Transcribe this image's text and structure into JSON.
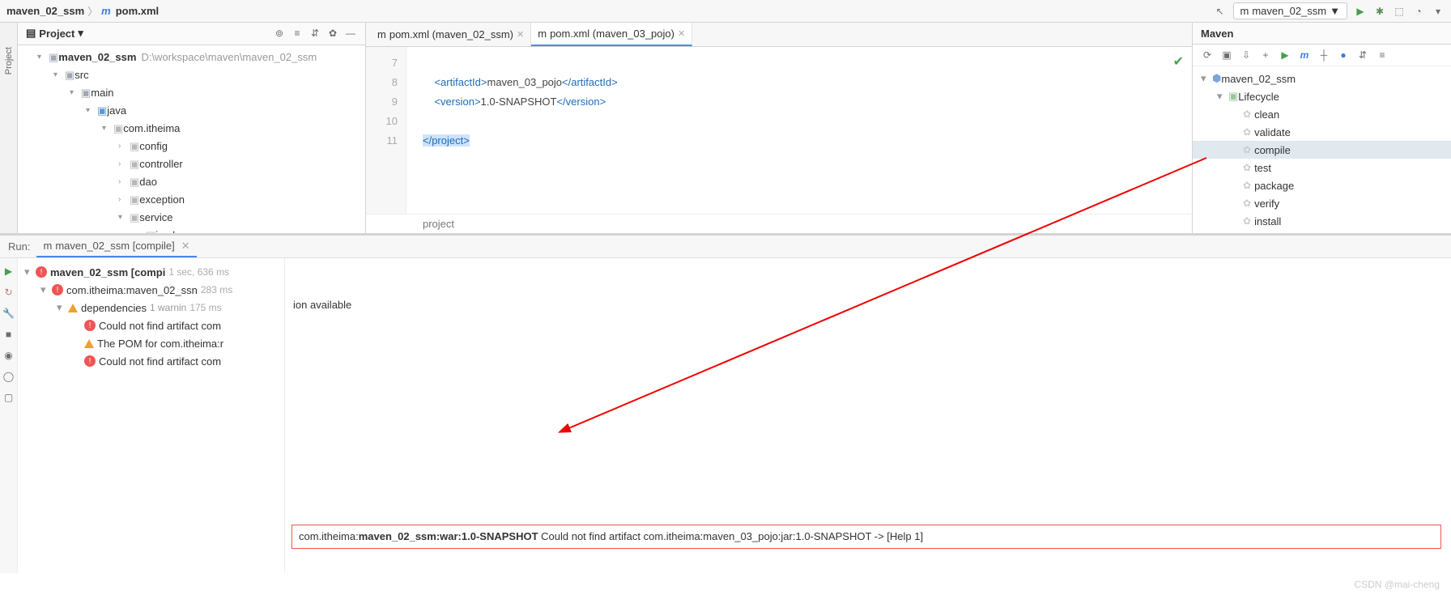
{
  "breadcrumb": {
    "root": "maven_02_ssm",
    "file": "pom.xml"
  },
  "runConfig": {
    "label": "maven_02_ssm"
  },
  "project": {
    "panelTitle": "Project",
    "root": {
      "name": "maven_02_ssm",
      "path": "D:\\workspace\\maven\\maven_02_ssm"
    },
    "nodes": [
      "src",
      "main",
      "java",
      "com.itheima",
      "config",
      "controller",
      "dao",
      "exception",
      "service",
      "impl"
    ]
  },
  "editor": {
    "tabs": [
      {
        "label": "pom.xml (maven_02_ssm)"
      },
      {
        "label": "pom.xml (maven_03_pojo)"
      }
    ],
    "lines": [
      "7",
      "8",
      "9",
      "10",
      "11"
    ],
    "l8": {
      "tag1": "<artifactId>",
      "txt": "maven_03_pojo",
      "tag2": "</artifactId>"
    },
    "l9": {
      "tag1": "<version>",
      "txt": "1.0-SNAPSHOT",
      "tag2": "</version>"
    },
    "l11": "</project>",
    "breadcrumb": "project"
  },
  "maven": {
    "title": "Maven",
    "root": "maven_02_ssm",
    "lifecycle": "Lifecycle",
    "goals": [
      "clean",
      "validate",
      "compile",
      "test",
      "package",
      "verify",
      "install"
    ]
  },
  "run": {
    "title": "Run:",
    "tab": "maven_02_ssm [compile]",
    "root": {
      "name": "maven_02_ssm [compi",
      "time": "1 sec, 636 ms"
    },
    "sub": {
      "name": "com.itheima:maven_02_ssn",
      "time": "283 ms"
    },
    "deps": {
      "name": "dependencies",
      "warn": "1 warnin",
      "time": "175 ms"
    },
    "items": [
      "Could not find artifact com",
      "The POM for com.itheima:r",
      "Could not find artifact com"
    ],
    "frag": "ion available",
    "error": {
      "pre": "com.itheima:",
      "art": "maven_02_ssm:war:1.0-SNAPSHOT",
      "msg": "  Could not find artifact com.itheima:maven_03_pojo:jar:1.0-SNAPSHOT -> [Help 1]"
    }
  },
  "watermark": "CSDN @mai-cheng"
}
